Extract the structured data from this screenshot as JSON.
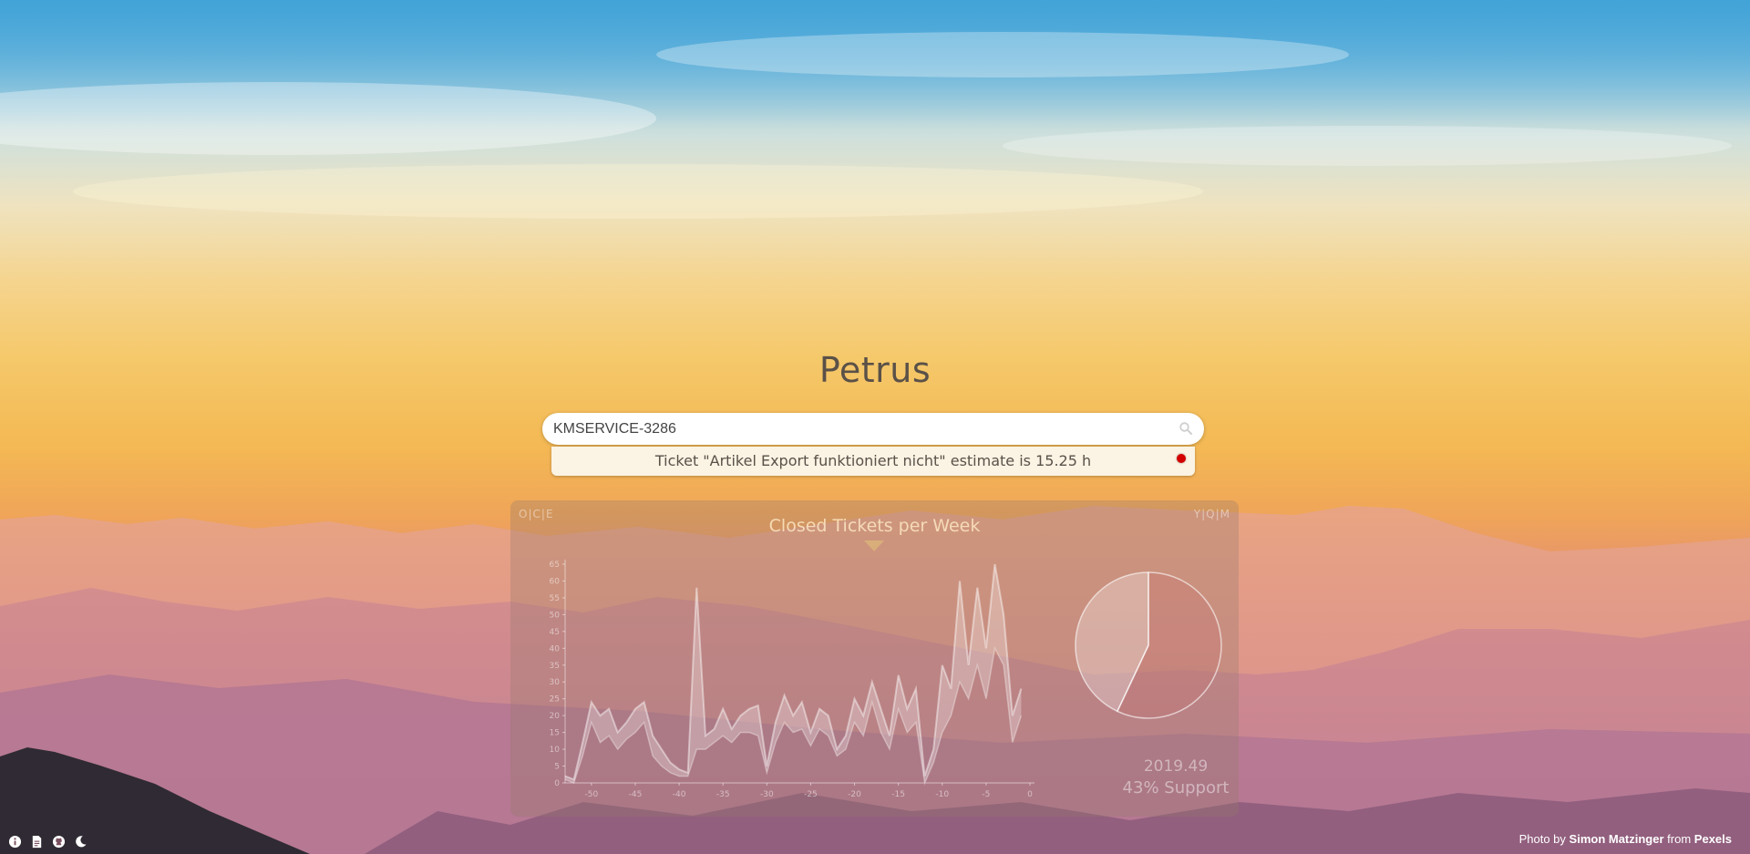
{
  "app": {
    "title": "Petrus"
  },
  "search": {
    "value": "KMSERVICE-3286",
    "placeholder": ""
  },
  "result": {
    "text": "Ticket \"Artikel Export funktioniert nicht\" estimate is 15.25 h",
    "status_color": "#d40000"
  },
  "chart_panel": {
    "left_links": [
      "O",
      "C",
      "E"
    ],
    "right_links": [
      "Y",
      "Q",
      "M"
    ],
    "separator": "|"
  },
  "chart_data": [
    {
      "type": "area",
      "title": "Closed Tickets per Week",
      "xlabel": "",
      "ylabel": "",
      "x_ticks": [
        -50,
        -45,
        -40,
        -35,
        -30,
        -25,
        -20,
        -15,
        -10,
        -5,
        0
      ],
      "y_ticks": [
        0,
        5,
        10,
        15,
        20,
        25,
        30,
        35,
        40,
        45,
        50,
        55,
        60,
        65
      ],
      "xlim": [
        -53,
        0
      ],
      "ylim": [
        0,
        65
      ],
      "grid": false,
      "series": [
        {
          "x": [
            -53,
            -52,
            -51,
            -50,
            -49,
            -48,
            -47,
            -46,
            -45,
            -44,
            -43,
            -42,
            -41,
            -40,
            -39,
            -38,
            -37,
            -36,
            -35,
            -34,
            -33,
            -32,
            -31,
            -30,
            -29,
            -28,
            -27,
            -26,
            -25,
            -24,
            -23,
            -22,
            -21,
            -20,
            -19,
            -18,
            -17,
            -16,
            -15,
            -14,
            -13,
            -12,
            -11,
            -10,
            -9,
            -8,
            -7,
            -6,
            -5,
            -4,
            -3,
            -2,
            -1
          ],
          "upper": [
            2,
            1,
            12,
            24,
            20,
            22,
            15,
            18,
            22,
            24,
            14,
            10,
            6,
            4,
            3,
            58,
            14,
            16,
            22,
            16,
            20,
            22,
            23,
            5,
            18,
            26,
            20,
            24,
            15,
            22,
            20,
            10,
            14,
            25,
            20,
            30,
            22,
            14,
            32,
            22,
            28,
            2,
            10,
            35,
            28,
            60,
            35,
            58,
            40,
            65,
            50,
            20,
            28,
            48
          ],
          "lower": [
            1,
            0,
            8,
            18,
            12,
            14,
            10,
            13,
            15,
            18,
            8,
            5,
            3,
            2,
            2,
            10,
            10,
            12,
            14,
            12,
            15,
            15,
            14,
            3,
            12,
            18,
            15,
            16,
            11,
            16,
            14,
            8,
            10,
            18,
            14,
            24,
            15,
            10,
            22,
            15,
            18,
            0,
            6,
            15,
            20,
            30,
            25,
            35,
            25,
            40,
            35,
            12,
            20,
            30
          ]
        }
      ]
    },
    {
      "type": "pie",
      "values": [
        57,
        43
      ],
      "total_label": "2019.49",
      "share_label": "43% Support"
    }
  ],
  "footer": {
    "icons": [
      "info-icon",
      "document-icon",
      "github-icon",
      "moon-icon"
    ],
    "credit_prefix": "Photo by",
    "credit_author": "Simon Matzinger",
    "credit_middle": "from",
    "credit_source": "Pexels"
  }
}
